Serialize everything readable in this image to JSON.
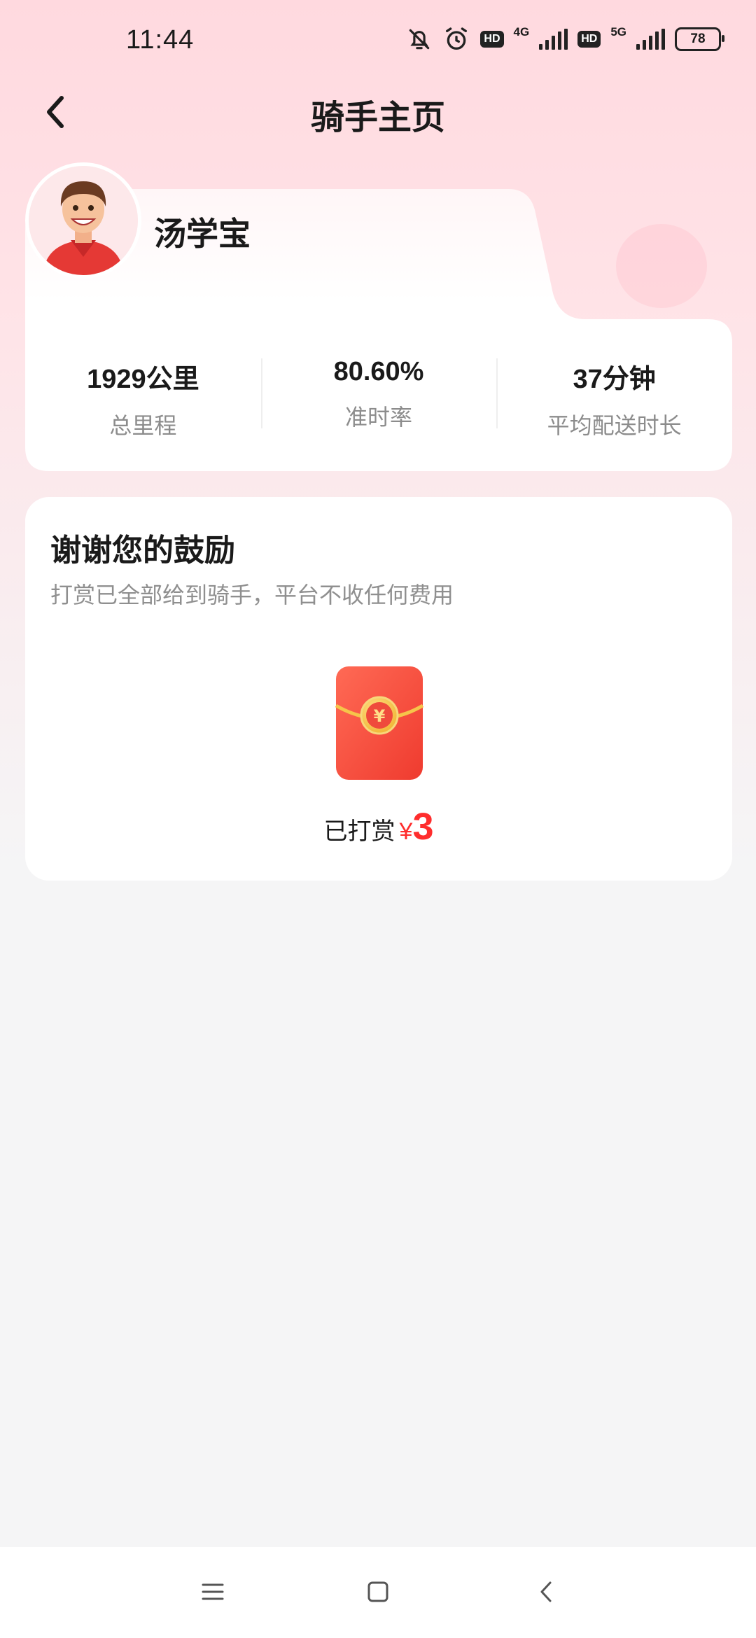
{
  "status_bar": {
    "time": "11:44",
    "hd_label": "HD",
    "network_1": "4G",
    "network_2": "5G",
    "battery": "78"
  },
  "header": {
    "title": "骑手主页"
  },
  "rider": {
    "name": "汤学宝",
    "stats": [
      {
        "value": "1929公里",
        "label": "总里程"
      },
      {
        "value": "80.60%",
        "label": "准时率"
      },
      {
        "value": "37分钟",
        "label": "平均配送时长"
      }
    ]
  },
  "tip": {
    "title": "谢谢您的鼓励",
    "subtitle": "打赏已全部给到骑手，平台不收任何费用",
    "status_label": "已打赏",
    "currency": "¥",
    "amount": "3"
  },
  "colors": {
    "accent": "#ff2d2d",
    "envelope": "#f4433a",
    "coin": "#f6c54a"
  },
  "icons": {
    "back": "chevron-left-icon",
    "muted": "bell-off-icon",
    "alarm": "alarm-icon",
    "nav_menu": "menu-icon",
    "nav_home": "square-icon",
    "nav_back": "chevron-left-icon"
  }
}
